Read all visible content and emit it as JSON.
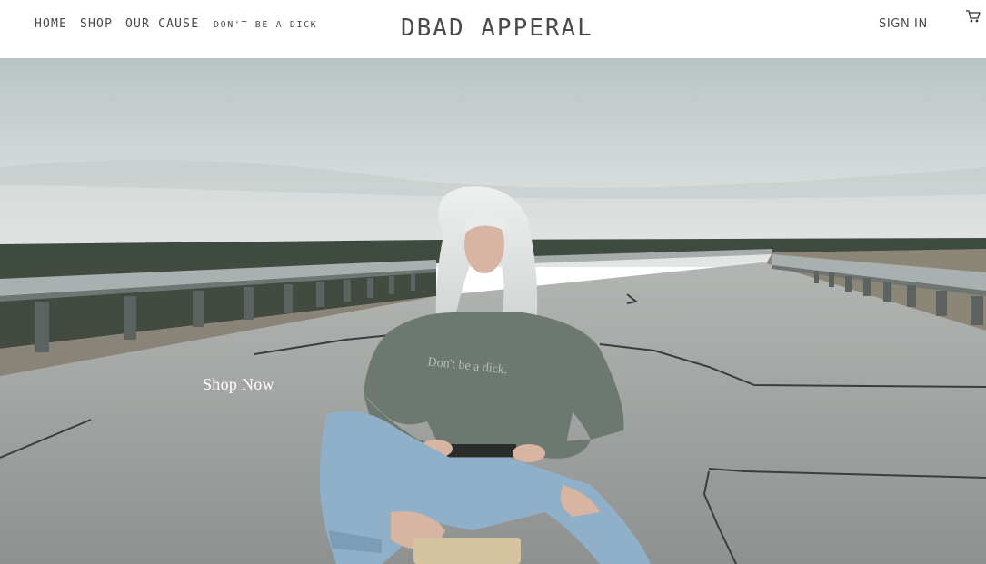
{
  "nav": {
    "home": "HOME",
    "shop": "SHOP",
    "our_cause": "OUR CAUSE",
    "tagline": "DON'T BE A DICK"
  },
  "brand": {
    "title": "DBAD APPERAL"
  },
  "account": {
    "sign_in": "SIGN IN"
  },
  "cart": {
    "icon": "cart-icon"
  },
  "hero": {
    "cta": "Shop Now",
    "shirt_text": "Don't be a dick."
  },
  "colors": {
    "text": "#4a4a4a",
    "header_bg": "#ffffff",
    "sky": "#c9d1d2",
    "road": "#9a9d9b",
    "sweater": "#6e7a72",
    "jeans": "#8fb0c8"
  }
}
